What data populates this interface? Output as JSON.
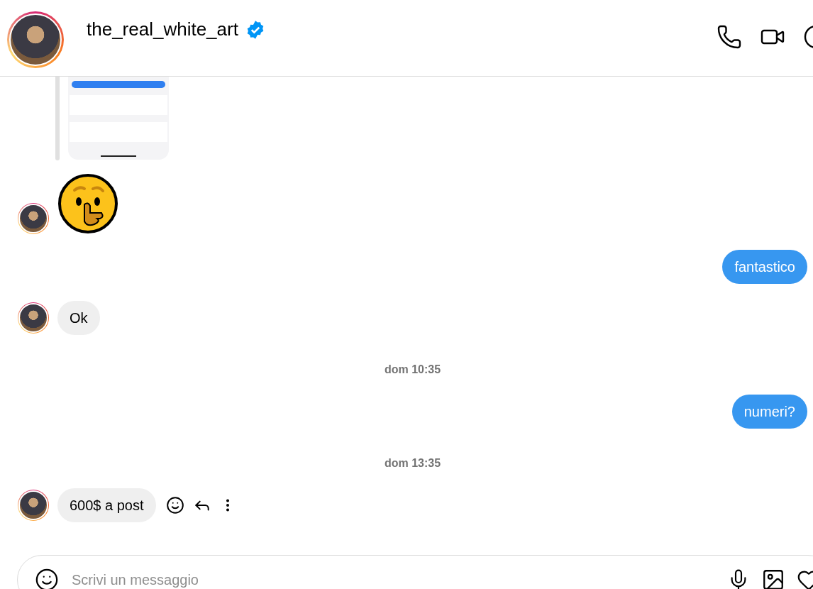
{
  "header": {
    "username": "the_real_white_art",
    "verified": true
  },
  "messages": [
    {
      "kind": "image",
      "sent": false,
      "avatar": false
    },
    {
      "kind": "emoji",
      "sent": false,
      "avatar": true
    },
    {
      "kind": "text",
      "sent": true,
      "text": "fantastico"
    },
    {
      "kind": "text",
      "sent": false,
      "avatar": true,
      "text": "Ok"
    },
    {
      "kind": "time",
      "text": "dom 10:35"
    },
    {
      "kind": "text",
      "sent": true,
      "text": "numeri?"
    },
    {
      "kind": "time",
      "text": "dom 13:35"
    },
    {
      "kind": "text",
      "sent": false,
      "avatar": true,
      "text": "600$ a post",
      "hovered": true
    }
  ],
  "composer": {
    "placeholder": "Scrivi un messaggio"
  }
}
